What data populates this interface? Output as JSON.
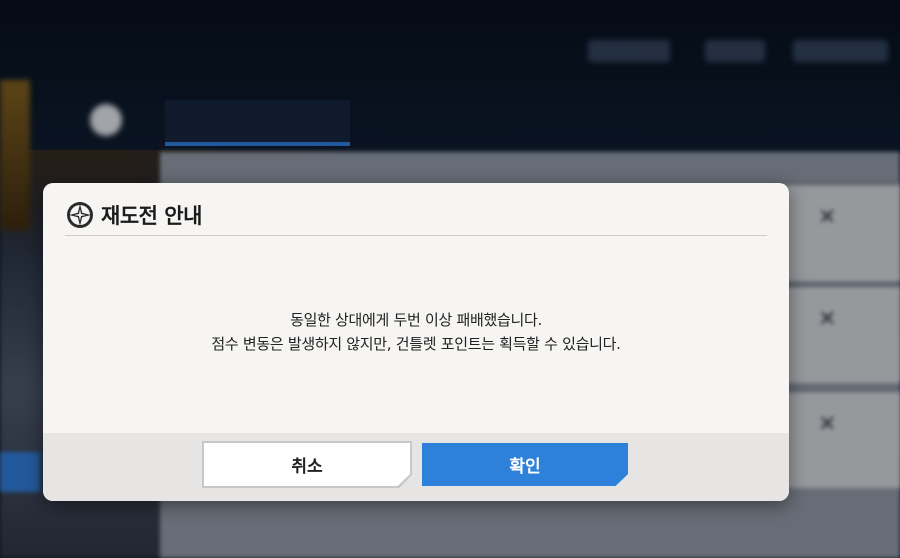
{
  "dialog": {
    "title": "재도전 안내",
    "message_line1": "동일한 상대에게 두번 이상 패배했습니다.",
    "message_line2": "점수 변동은 발생하지 않지만, 건틀렛 포인트는 획득할 수 있습니다.",
    "cancel_label": "취소",
    "confirm_label": "확인"
  },
  "colors": {
    "confirm_button": "#2e81db",
    "dialog_bg": "#f6f5f3",
    "footer_bg": "#e6e5e3"
  },
  "icons": {
    "title_icon": "compass-star-logo-icon",
    "close_marks": "close-icon"
  }
}
